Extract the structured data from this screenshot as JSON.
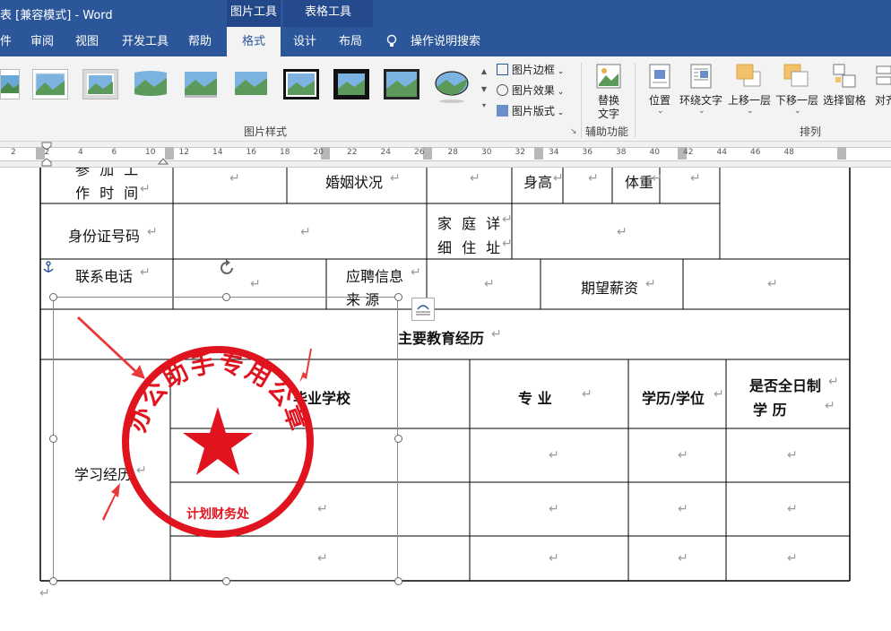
{
  "window": {
    "title": "表 [兼容模式] - Word",
    "ctx_picture_tools": "图片工具",
    "ctx_table_tools": "表格工具"
  },
  "tabs": [
    {
      "label": "件"
    },
    {
      "label": "审阅"
    },
    {
      "label": "视图"
    },
    {
      "label": "开发工具"
    },
    {
      "label": "帮助"
    },
    {
      "label": "格式"
    },
    {
      "label": "设计"
    },
    {
      "label": "布局"
    }
  ],
  "tell_me": "操作说明搜索",
  "ribbon": {
    "picture_border": "图片边框",
    "picture_effects": "图片效果",
    "picture_layout": "图片版式",
    "styles_group": "图片样式",
    "alt_text_line1": "替换",
    "alt_text_line2": "文字",
    "accessibility_group": "辅助功能",
    "position": "位置",
    "wrap_text": "环绕文字",
    "bring_forward": "上移一层",
    "send_backward": "下移一层",
    "selection_pane": "选择窗格",
    "align": "对齐",
    "arrange_group": "排列"
  },
  "ruler": {
    "ticks": [
      "2",
      "2",
      "4",
      "6",
      "10",
      "12",
      "14",
      "16",
      "18",
      "20",
      "22",
      "24",
      "26",
      "28",
      "30",
      "32",
      "34",
      "36",
      "38",
      "40",
      "42",
      "44",
      "46",
      "48"
    ]
  },
  "document": {
    "work_time_1": "参 加 工",
    "work_time_2": "作 时 间",
    "marital": "婚姻状况",
    "height": "身高",
    "weight": "体重",
    "id_number": "身份证号码",
    "home_addr_1": "家 庭 详",
    "home_addr_2": "细 住 址",
    "phone": "联系电话",
    "source_1": "应聘信息",
    "source_2": "来     源",
    "salary": "期望薪资",
    "education_header": "主要教育经历",
    "school": "毕业学校",
    "major": "专      业",
    "degree": "学历/学位",
    "fulltime_1": "是否全日制",
    "fulltime_2": "学      历",
    "study_exp": "学习经历",
    "return_mark": "↵"
  },
  "seal": {
    "top_text": "办公助手专用公章",
    "bottom_text": "计划财务处",
    "color": "#e0141e"
  },
  "colors": {
    "word_blue": "#2b579a",
    "ribbon_bg": "#f3f3f3",
    "arrow_red": "#e83a3a"
  }
}
